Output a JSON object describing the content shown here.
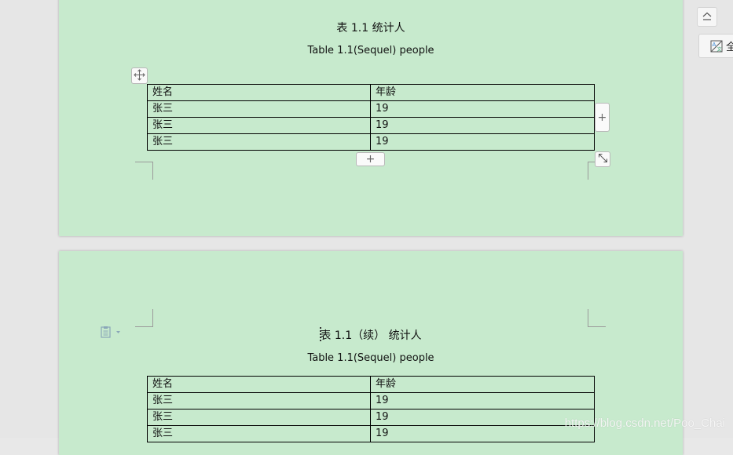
{
  "page1": {
    "caption_zh": "表 1.1  统计人",
    "caption_en": "Table 1.1(Sequel) people",
    "table": {
      "header": [
        "姓名",
        "年龄"
      ],
      "rows": [
        [
          "张三",
          "19"
        ],
        [
          "张三",
          "19"
        ],
        [
          "张三",
          "19"
        ]
      ]
    }
  },
  "page2": {
    "caption_zh": "表  1.1（续） 统计人",
    "caption_en": "Table 1.1(Sequel) people",
    "table": {
      "header": [
        "姓名",
        "年龄"
      ],
      "rows": [
        [
          "张三",
          "19"
        ],
        [
          "张三",
          "19"
        ],
        [
          "张三",
          "19"
        ]
      ]
    }
  },
  "controls": {
    "add_column": "+",
    "add_row": "+",
    "side_label": "全"
  },
  "icons": {
    "move": "move-arrows-icon",
    "resize": "diagonal-resize-icon",
    "paste": "paste-options-icon",
    "collapse": "eject-collapse-icon",
    "translate": "translate-icon"
  },
  "watermark": "https://blog.csdn.net/Poo_Chai",
  "colors": {
    "page_bg": "#c7eacd",
    "canvas_bg": "#e6e6e6"
  }
}
